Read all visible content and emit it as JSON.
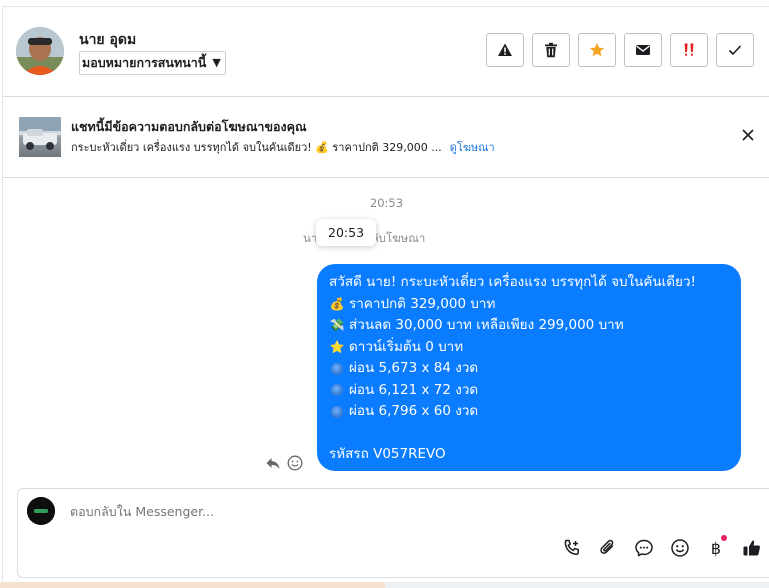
{
  "header": {
    "contact_name": "นาย อุดม",
    "assign_label": "มอบหมายการสนทนานี้"
  },
  "banner": {
    "title": "แชทนี้มีข้อความตอบกลับต่อโฆษณาของคุณ",
    "preview": "กระบะหัวเดี่ยว เครื่องแรง บรรทุกได้ จบในคันเดียว! 💰 ราคาปกติ 329,000 ...",
    "link": "ดูโฆษณา"
  },
  "thread": {
    "timestamp": "20:53",
    "context_left": "นา",
    "context_right": "บกลับโฆษณา",
    "tooltip": "20:53",
    "message": {
      "line1": "สวัสดี นาย! กระบะหัวเดี่ยว เครื่องแรง บรรทุกได้ จบในคันเดียว!",
      "line2": "ราคาปกติ 329,000 บาท",
      "line3": "ส่วนลด 30,000 บาท เหลือเพียง 299,000 บาท",
      "line4": "ดาวน์เริ่มต้น 0 บาท",
      "line5": "ผ่อน 5,673 x 84 งวด",
      "line6": "ผ่อน 6,121 x 72 งวด",
      "line7": "ผ่อน 6,796 x 60 งวด",
      "line8": "รหัสรถ V057REVO",
      "emoji_money": "💰",
      "emoji_discount": "💸",
      "emoji_star": "⭐"
    }
  },
  "composer": {
    "placeholder": "ตอบกลับใน Messenger...",
    "baht_symbol": "฿"
  },
  "colors": {
    "bubble": "#0a7cff",
    "link": "#1d74d8",
    "star": "#f5a623",
    "urgent": "#e02020"
  }
}
